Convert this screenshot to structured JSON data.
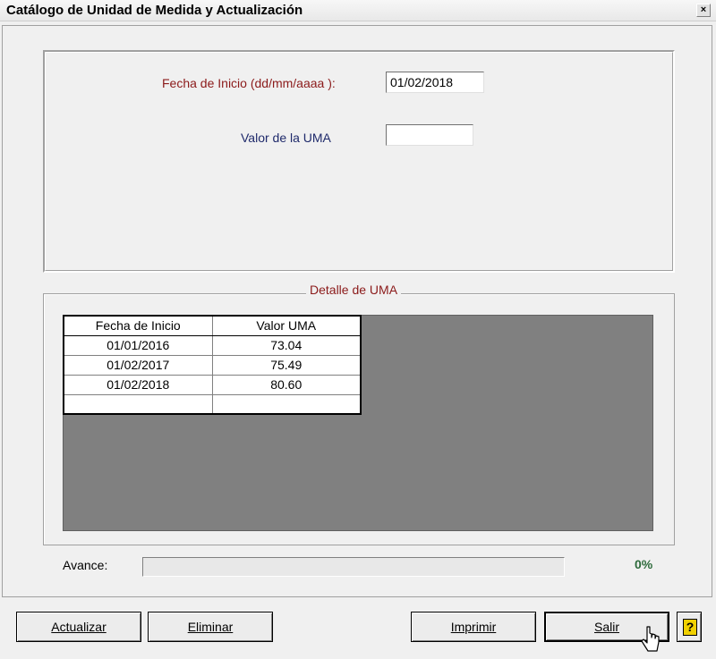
{
  "window": {
    "title": "Catálogo de Unidad de Medida y Actualización",
    "close_glyph": "×"
  },
  "form": {
    "fecha_label": "Fecha de Inicio (dd/mm/aaaa ):",
    "fecha_value": "01/02/2018",
    "valor_label": "Valor de la UMA",
    "valor_value": ""
  },
  "detalle": {
    "caption": "Detalle de UMA",
    "columns": [
      "Fecha de Inicio",
      "Valor UMA"
    ],
    "rows": [
      [
        "01/01/2016",
        "73.04"
      ],
      [
        "01/02/2017",
        "75.49"
      ],
      [
        "01/02/2018",
        "80.60"
      ],
      [
        "",
        ""
      ]
    ]
  },
  "progress": {
    "label": "Avance:",
    "percent_text": "0%",
    "value": 0
  },
  "buttons": {
    "actualizar": "Actualizar",
    "eliminar": "Eliminar",
    "imprimir": "Imprimir",
    "salir": "Salir",
    "help_glyph": "?"
  },
  "colors": {
    "label_red": "#8b1a1a",
    "label_blue": "#1f2a6b",
    "percent_green": "#2e6b3c",
    "help_yellow": "#f0d000",
    "grid_background": "#808080"
  },
  "icons": [
    "close-icon",
    "help-icon",
    "mouse-cursor-icon"
  ]
}
